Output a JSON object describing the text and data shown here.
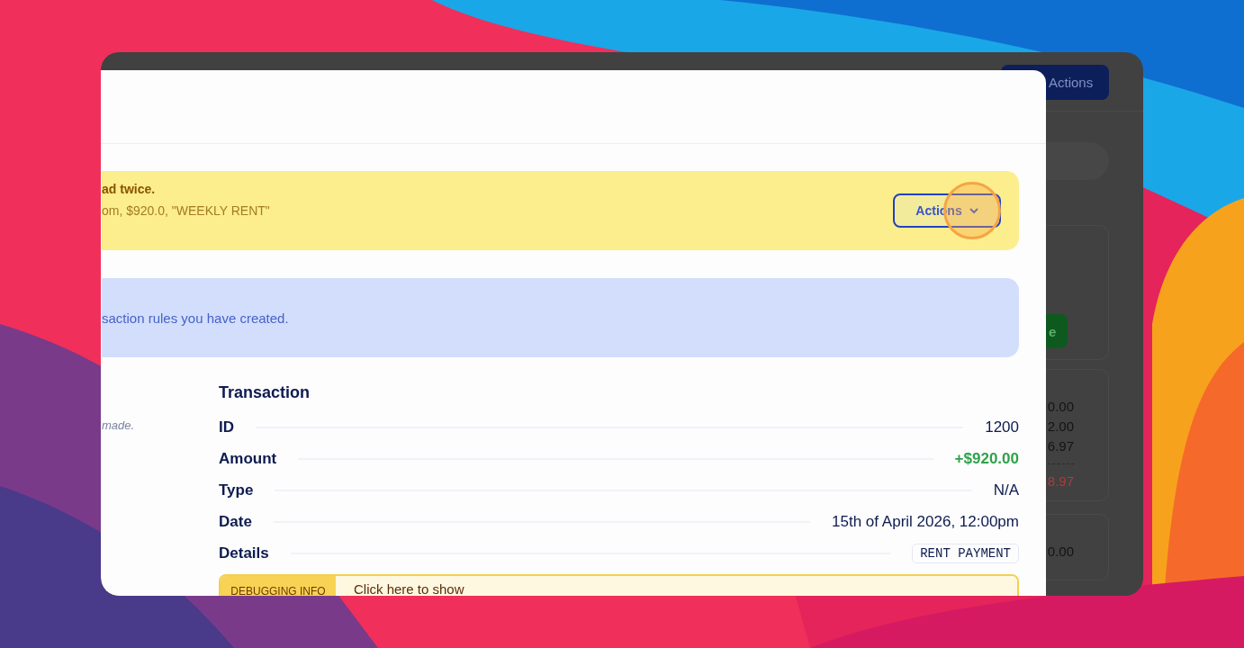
{
  "background_app": {
    "actions_button": "Actions",
    "side_button_partial": "e",
    "amounts": [
      {
        "text": "0.00",
        "kind": "normal"
      },
      {
        "text": "2.00",
        "kind": "normal"
      },
      {
        "text": "6.97",
        "kind": "normal"
      },
      {
        "text": "8.97",
        "kind": "negative"
      },
      {
        "text": "0.00",
        "kind": "separate"
      }
    ]
  },
  "modal": {
    "duplicate_alert": {
      "title": "ad twice.",
      "details": "om, $920.0, \"WEEKLY RENT\"",
      "actions_button": "Actions"
    },
    "info_alert": {
      "text": "saction rules you have created."
    },
    "side_note": "made.",
    "transaction": {
      "heading": "Transaction",
      "rows": [
        {
          "label": "ID",
          "value": "1200",
          "kind": "text"
        },
        {
          "label": "Amount",
          "value": "+$920.00",
          "kind": "positive"
        },
        {
          "label": "Type",
          "value": "N/A",
          "kind": "text"
        },
        {
          "label": "Date",
          "value": "15th of April 2026, 12:00pm",
          "kind": "text"
        },
        {
          "label": "Details",
          "value": "RENT PAYMENT",
          "kind": "tag"
        }
      ]
    },
    "debug": {
      "label": "DEBUGGING INFO",
      "action": "Click here to show"
    }
  }
}
